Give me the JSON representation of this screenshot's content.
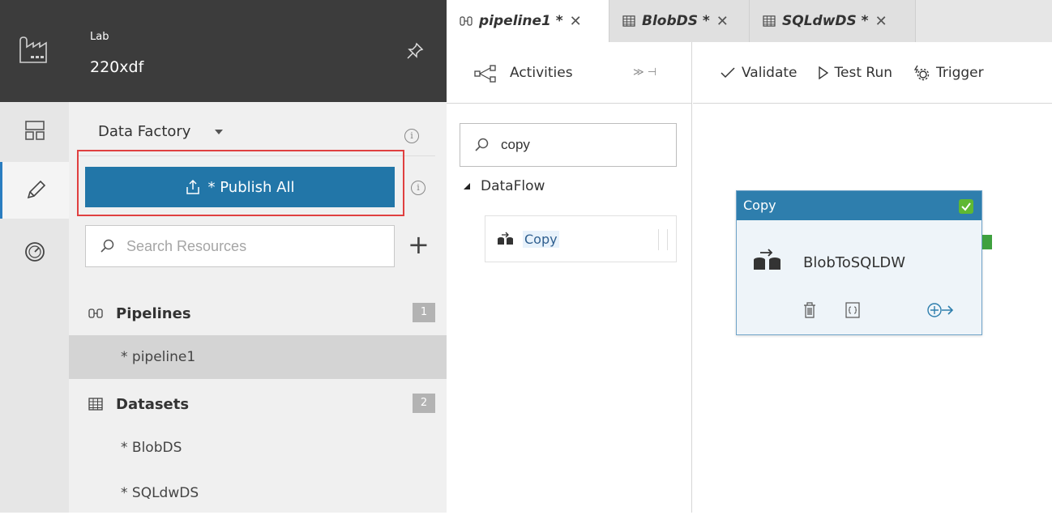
{
  "header": {
    "subtitle": "Lab",
    "title": "220xdf"
  },
  "factory": {
    "title": "Data Factory",
    "publish_label": "* Publish All",
    "search_placeholder": "Search Resources",
    "sections": [
      {
        "label": "Pipelines",
        "count": "1",
        "items": [
          "* pipeline1"
        ]
      },
      {
        "label": "Datasets",
        "count": "2",
        "items": [
          "* BlobDS",
          "* SQLdwDS"
        ]
      }
    ]
  },
  "tabs": [
    {
      "label": "pipeline1 *",
      "active": true
    },
    {
      "label": "BlobDS *",
      "active": false
    },
    {
      "label": "SQLdwDS *",
      "active": false
    }
  ],
  "activities": {
    "title": "Activities",
    "search_value": "copy",
    "group": "DataFlow",
    "item": "Copy"
  },
  "toolbar": {
    "validate": "Validate",
    "test_run": "Test Run",
    "trigger": "Trigger"
  },
  "node": {
    "type": "Copy",
    "name": "BlobToSQLDW"
  },
  "colors": {
    "publish": "#2276a8",
    "node_header": "#2e7ead",
    "status_ok": "#5fb832",
    "highlight_outline": "#e04040"
  }
}
